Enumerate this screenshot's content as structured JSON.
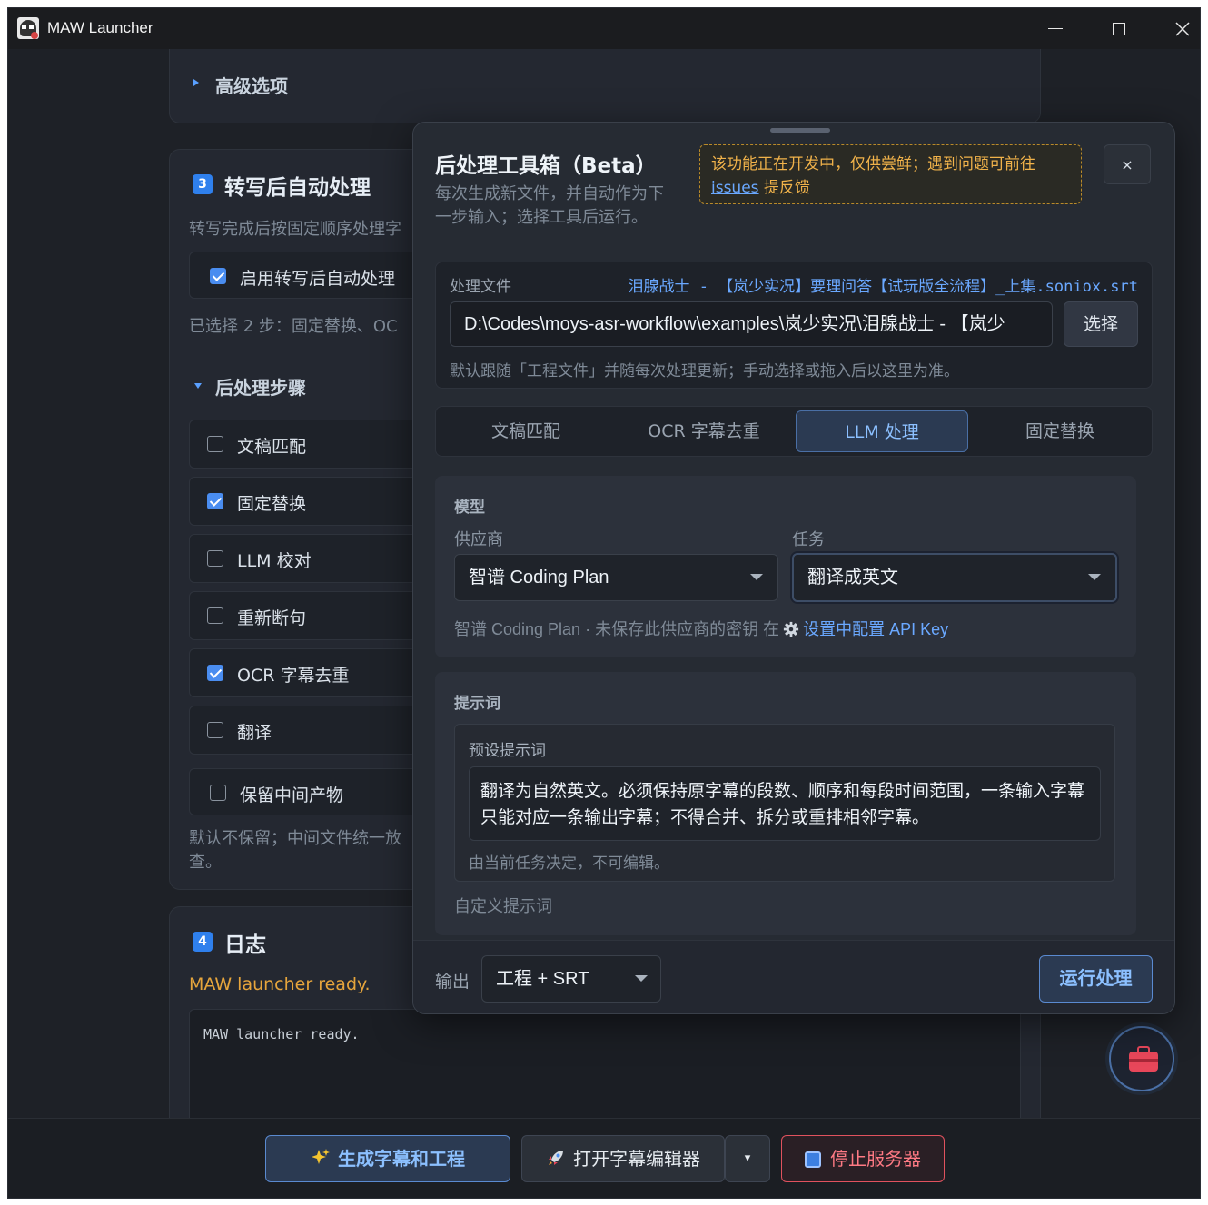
{
  "window": {
    "title": "MAW Launcher"
  },
  "advanced": {
    "label": "高级选项"
  },
  "step3": {
    "badge": "3",
    "title": "转写后自动处理",
    "description": "转写完成后按固定顺序处理字",
    "enable_label": "启用转写后自动处理",
    "selected_summary": "已选择 2 步：固定替换、OC",
    "steps_header": "后处理步骤",
    "steps": [
      {
        "label": "文稿匹配",
        "checked": false
      },
      {
        "label": "固定替换",
        "checked": true
      },
      {
        "label": "LLM 校对",
        "checked": false
      },
      {
        "label": "重新断句",
        "checked": false
      },
      {
        "label": "OCR 字幕去重",
        "checked": true
      },
      {
        "label": "翻译",
        "checked": false
      }
    ],
    "keep_intermediate_label": "保留中间产物",
    "keep_hint_line1": "默认不保留；中间文件统一放",
    "keep_hint_line2": "查。"
  },
  "log": {
    "badge": "4",
    "title": "日志",
    "status": "MAW launcher ready.",
    "output": "MAW launcher ready."
  },
  "toolbox_panel": {
    "title": "后处理工具箱（Beta）",
    "description": "每次生成新文件，并自动作为下一步输入；选择工具后运行。",
    "warning_text": "该功能正在开发中，仅供尝鲜；遇到问题可前往",
    "warning_link": "issues",
    "warning_suffix": "提反馈",
    "close_label": "×",
    "file": {
      "label": "处理文件",
      "name": "泪腺战士 - 【岚少实况】要理问答【试玩版全流程】_上集.soniox.srt",
      "path": "D:\\Codes\\moys-asr-workflow\\examples\\岚少实况\\泪腺战士 - 【岚少",
      "choose_label": "选择",
      "hint": "默认跟随「工程文件」并随每次处理更新；手动选择或拖入后以这里为准。"
    },
    "tabs": [
      {
        "label": "文稿匹配",
        "active": false
      },
      {
        "label": "OCR 字幕去重",
        "active": false
      },
      {
        "label": "LLM 处理",
        "active": true
      },
      {
        "label": "固定替换",
        "active": false
      }
    ],
    "model": {
      "section_title": "模型",
      "provider_label": "供应商",
      "provider_value": "智谱 Coding Plan",
      "task_label": "任务",
      "task_value": "翻译成英文",
      "hint_prefix": "智谱 Coding Plan · 未保存此供应商的密钥 在",
      "hint_link": "设置中配置 API Key"
    },
    "prompt": {
      "section_title": "提示词",
      "preset_label": "预设提示词",
      "preset_text": "翻译为自然英文。必须保持原字幕的段数、顺序和每段时间范围，一条输入字幕只能对应一条输出字幕；不得合并、拆分或重排相邻字幕。",
      "preset_hint": "由当前任务决定，不可编辑。",
      "custom_label": "自定义提示词"
    },
    "output": {
      "label": "输出",
      "value": "工程 + SRT"
    },
    "run_label": "运行处理"
  },
  "bottom_bar": {
    "generate_label": "生成字幕和工程",
    "open_editor_label": "打开字幕编辑器",
    "split_label": "▾",
    "stop_label": "停止服务器"
  },
  "colors": {
    "accent": "#4a8df0",
    "warning": "#f0b24a",
    "danger": "#e0525e",
    "background": "#1e2127"
  }
}
